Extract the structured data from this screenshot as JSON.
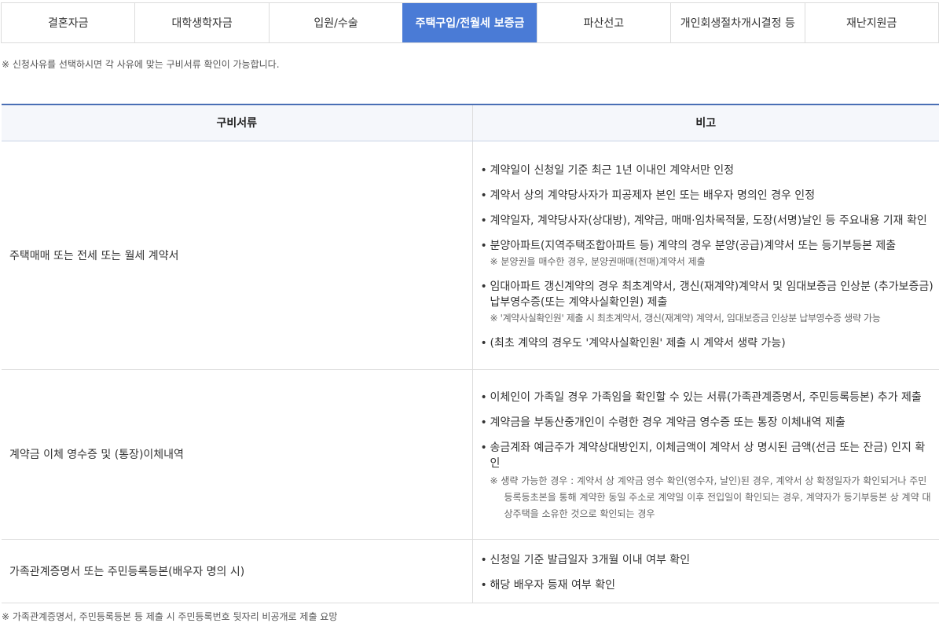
{
  "tabs": [
    {
      "label": "결혼자금",
      "active": false
    },
    {
      "label": "대학생학자금",
      "active": false
    },
    {
      "label": "입원/수술",
      "active": false
    },
    {
      "label": "주택구입/전월세 보증금",
      "active": true
    },
    {
      "label": "파산선고",
      "active": false
    },
    {
      "label": "개인회생절차개시결정 등",
      "active": false
    },
    {
      "label": "재난지원금",
      "active": false
    }
  ],
  "notice_top": "※ 신청사유를 선택하시면 각 사유에 맞는 구비서류 확인이 가능합니다.",
  "table": {
    "headers": {
      "documents": "구비서류",
      "remarks": "비고"
    },
    "rows": [
      {
        "document": "주택매매 또는 전세 또는 월세 계약서",
        "notes": [
          {
            "text": "계약일이 신청일 기준 최근 1년 이내인 계약서만 인정"
          },
          {
            "text": "계약서 상의 계약당사자가 피공제자 본인 또는 배우자 명의인 경우 인정"
          },
          {
            "text": "계약일자, 계약당사자(상대방), 계약금, 매매·임차목적물, 도장(서명)날인 등 주요내용 기재 확인"
          },
          {
            "text": "분양아파트(지역주택조합아파트 등) 계약의 경우 분양(공급)계약서 또는 등기부등본 제출",
            "sub": "※ 분양권을 매수한 경우, 분양권매매(전매)계약서 제출"
          },
          {
            "text": "임대아파트 갱신계약의 경우 최초계약서, 갱신(재계약)계약서 및 임대보증금 인상분 (추가보증금) 납부영수증(또는 계약사실확인원) 제출",
            "sub": "※ '계약사실확인원' 제출 시 최초계약서, 갱신(재계약) 계약서, 임대보증금 인상분 납부영수증 생략 가능"
          },
          {
            "text": "(최초 계약의 경우도 '계약사실확인원' 제출 시 계약서 생략 가능)"
          }
        ]
      },
      {
        "document": "계약금 이체 영수증 및 (통장)이체내역",
        "notes": [
          {
            "text": "이체인이 가족일 경우 가족임을 확인할 수 있는 서류(가족관계증명서, 주민등록등본) 추가 제출"
          },
          {
            "text": "계약금을 부동산중개인이 수령한 경우 계약금 영수증 또는 통장 이체내역 제출"
          },
          {
            "text": "송금계좌 예금주가 계약상대방인지, 이체금액이 계약서 상 명시된 금액(선금 또는 잔금) 인지 확인",
            "sub_multi": "※ 생략 가능한 경우 : 계약서 상 계약금 영수 확인(영수자, 날인)된 경우, 계약서 상 확정일자가 확인되거나 주민등록등초본을 통해 계약한 동일 주소로 계약일 이후 전입일이 확인되는 경우, 계약자가 등기부등본 상 계약 대상주택을 소유한 것으로 확인되는 경우"
          }
        ]
      },
      {
        "document": "가족관계증명서 또는 주민등록등본(배우자 명의 시)",
        "notes": [
          {
            "text": "신청일 기준 발급일자 3개월 이내 여부 확인"
          },
          {
            "text": "해당 배우자 등재 여부 확인"
          }
        ]
      }
    ]
  },
  "notice_bottom": "※ 가족관계증명서, 주민등록등본 등 제출 시 주민등록번호 뒷자리 비공개로 제출 요망",
  "colors": {
    "accent": "#4a7bd6",
    "header_border": "#4a6fb5",
    "header_bg": "#f5f7fb",
    "border": "#dcdcdc"
  }
}
